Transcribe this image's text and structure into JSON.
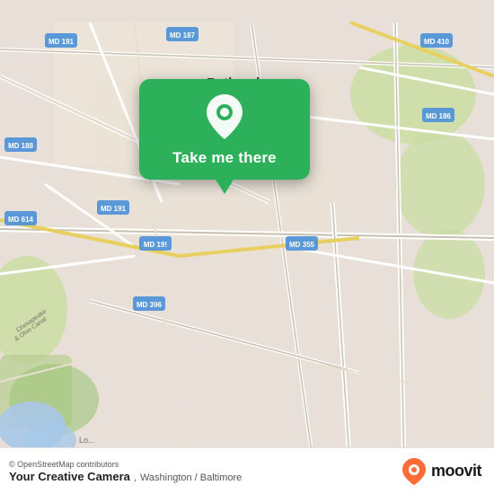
{
  "map": {
    "center": "Bethesda, MD",
    "attribution": "© OpenStreetMap contributors",
    "bg_color": "#e8e0d8"
  },
  "popup": {
    "button_label": "Take me there",
    "bg_color": "#2db05a"
  },
  "bottom_bar": {
    "location_name": "Your Creative Camera",
    "location_region": "Washington / Baltimore",
    "attribution": "© OpenStreetMap contributors",
    "moovit_label": "moovit"
  },
  "road_labels": [
    {
      "id": "md191_top",
      "text": "MD 191"
    },
    {
      "id": "md187",
      "text": "MD 187"
    },
    {
      "id": "md410",
      "text": "MD 410"
    },
    {
      "id": "md188",
      "text": "MD 188"
    },
    {
      "id": "md186",
      "text": "MD 186"
    },
    {
      "id": "md191_mid",
      "text": "MD 191"
    },
    {
      "id": "md614",
      "text": "MD 614"
    },
    {
      "id": "md191_low",
      "text": "MD 19!"
    },
    {
      "id": "md355",
      "text": "MD 355"
    },
    {
      "id": "md396",
      "text": "MD 396"
    },
    {
      "id": "bethesda",
      "text": "Bethesda"
    }
  ]
}
